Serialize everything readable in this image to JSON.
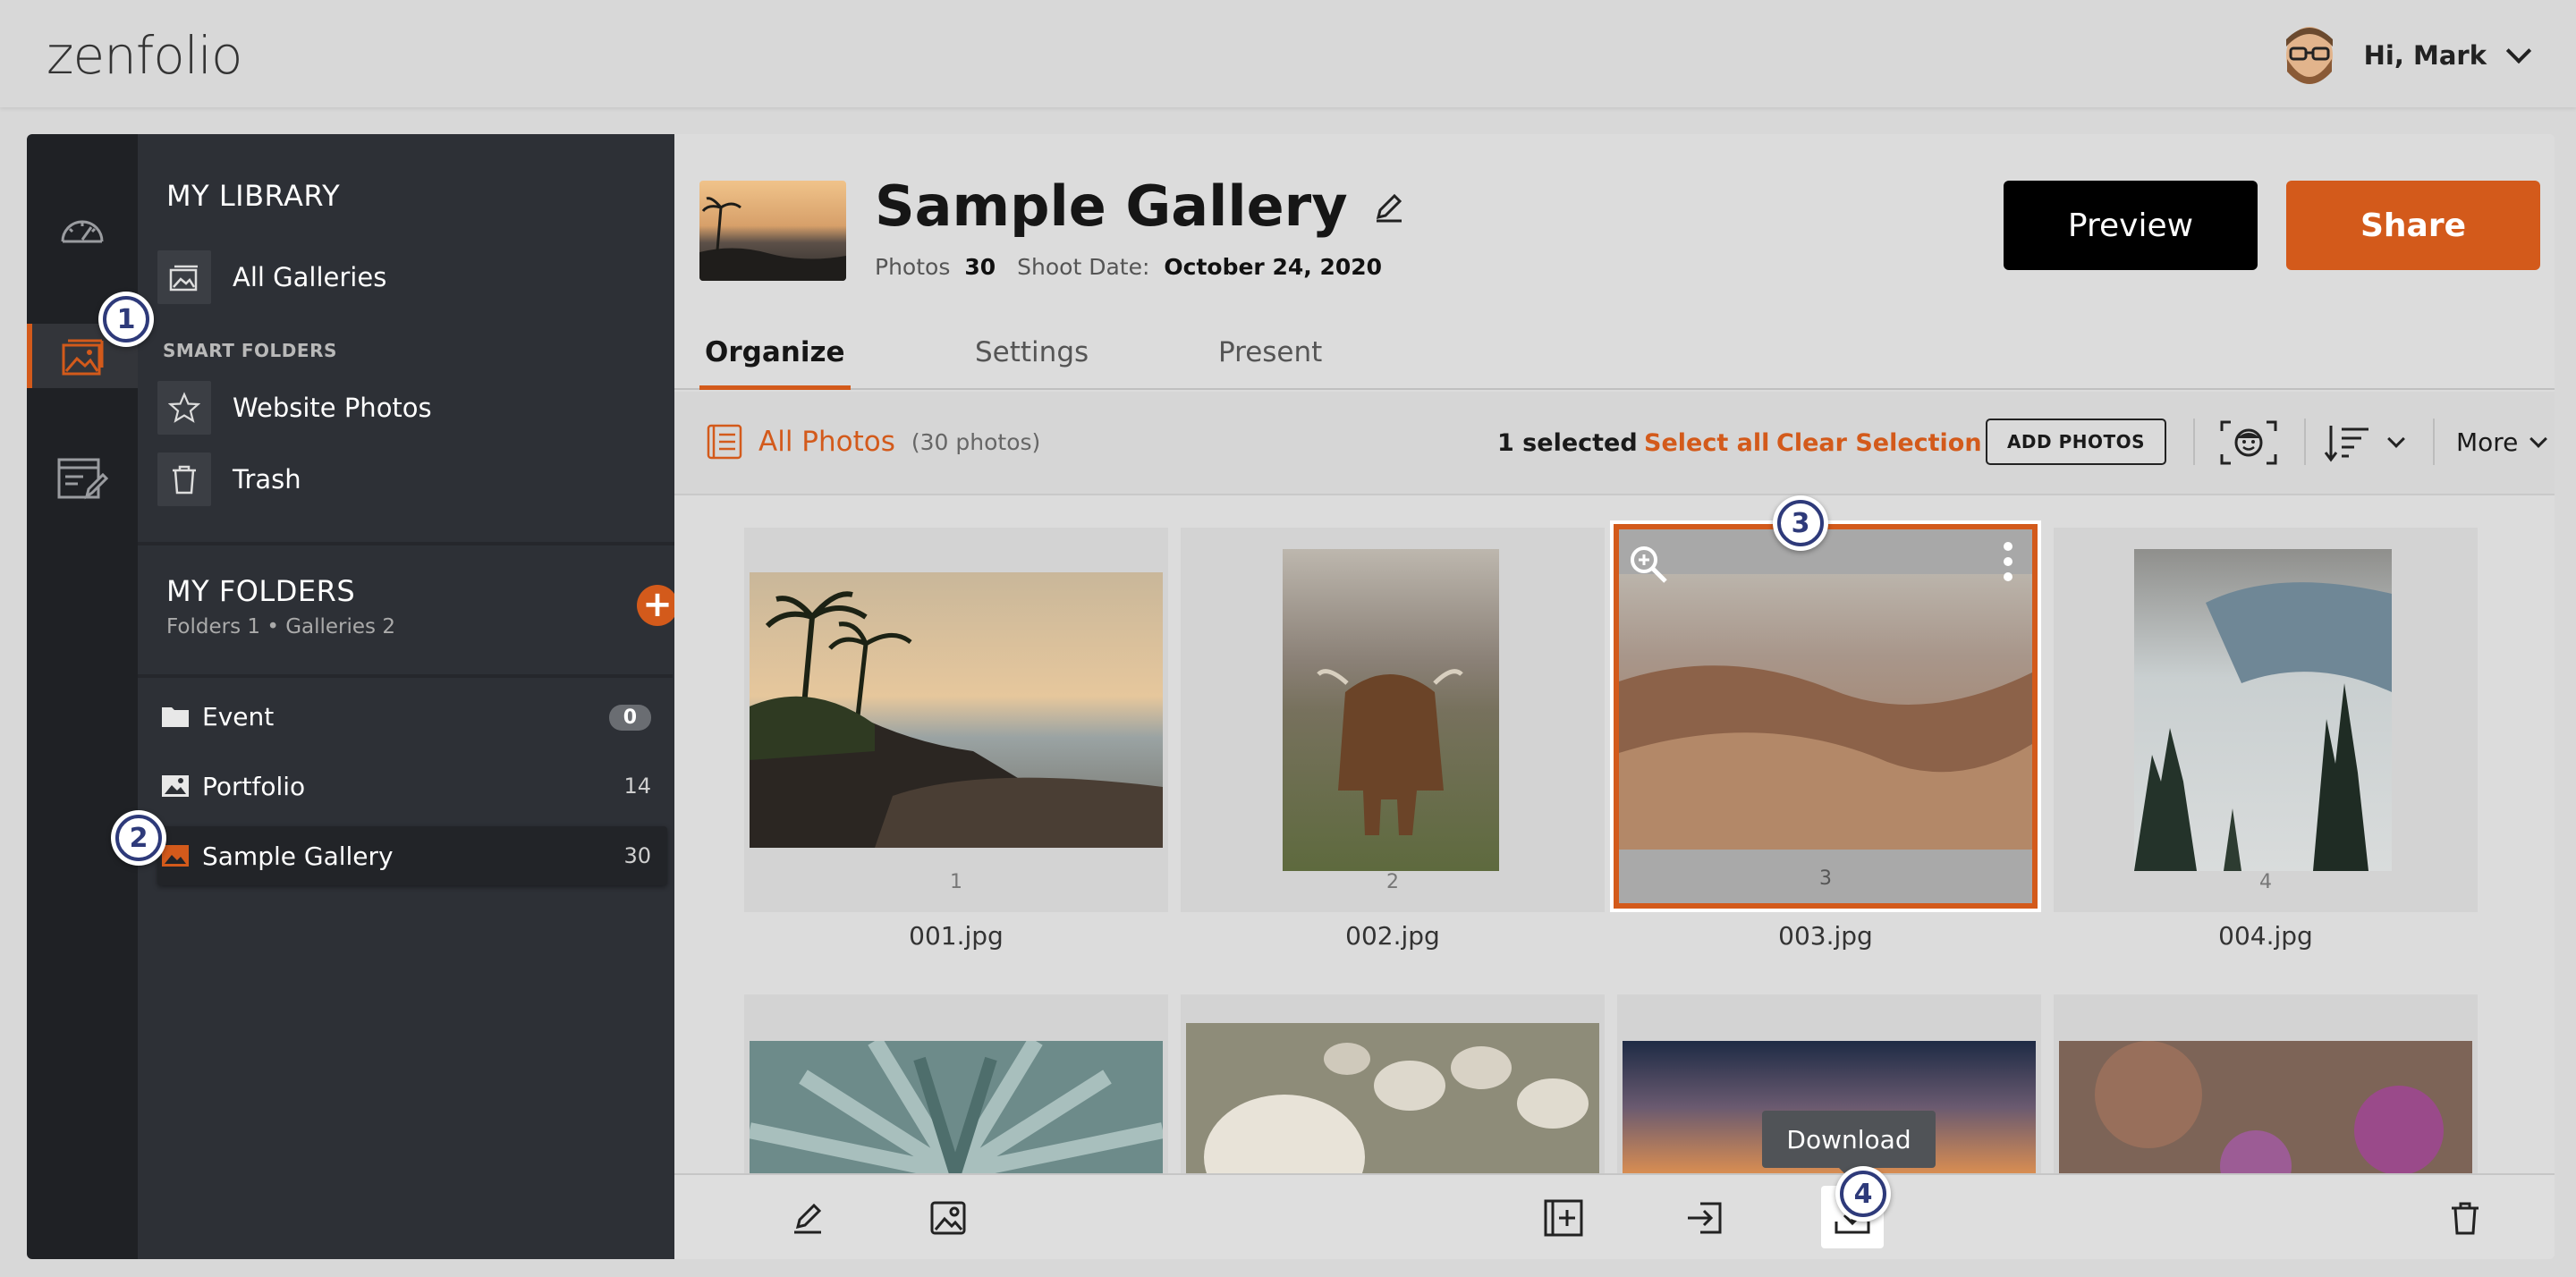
{
  "header": {
    "logo": "zenfolio",
    "greeting": "Hi, Mark"
  },
  "library": {
    "title": "MY LIBRARY",
    "all_galleries": "All Galleries",
    "smart_folders_label": "SMART FOLDERS",
    "smart_folders": [
      "Website Photos",
      "Trash"
    ],
    "my_folders_title": "MY FOLDERS",
    "my_folders_sub": "Folders 1 • Galleries 2",
    "folders": [
      {
        "name": "Event",
        "count": "0"
      },
      {
        "name": "Portfolio",
        "count": "14"
      },
      {
        "name": "Sample Gallery",
        "count": "30"
      }
    ]
  },
  "gallery": {
    "title": "Sample Gallery",
    "photos_label": "Photos",
    "photos_count": "30",
    "shoot_label": "Shoot Date:",
    "shoot_date": "October 24, 2020",
    "preview": "Preview",
    "share": "Share"
  },
  "tabs": [
    "Organize",
    "Settings",
    "Present"
  ],
  "toolbar": {
    "all_photos": "All Photos",
    "all_photos_count": "(30 photos)",
    "selected": "1 selected",
    "select_all": "Select all",
    "clear_selection": "Clear Selection",
    "add_photos": "ADD PHOTOS",
    "more": "More"
  },
  "photos": [
    {
      "num": "1",
      "name": "001.jpg"
    },
    {
      "num": "2",
      "name": "002.jpg"
    },
    {
      "num": "3",
      "name": "003.jpg"
    },
    {
      "num": "4",
      "name": "004.jpg"
    }
  ],
  "tooltip": "Download",
  "badges": [
    "1",
    "2",
    "3",
    "4"
  ],
  "colors": {
    "accent": "#d35a1b",
    "sidebar": "#2d3036",
    "rail": "#1f2125",
    "badge": "#2e3a7a"
  }
}
